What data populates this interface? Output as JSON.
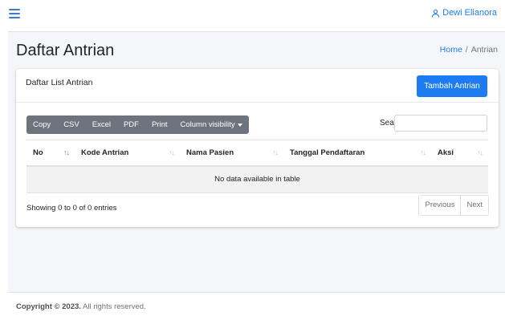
{
  "navbar": {
    "user_name": "Dewi Elianora"
  },
  "page": {
    "title": "Daftar Antrian",
    "breadcrumb": {
      "home": "Home",
      "separator": "/",
      "current": "Antrian"
    }
  },
  "card": {
    "title": "Daftar List Antrian",
    "add_button": "Tambah Antrian"
  },
  "toolbar": {
    "buttons": [
      "Copy",
      "CSV",
      "Excel",
      "PDF",
      "Print",
      "Column visibility"
    ]
  },
  "search": {
    "label": "Search:",
    "value": ""
  },
  "table": {
    "columns": [
      "No",
      "Kode Antrian",
      "Nama Pasien",
      "Tanggal Pendaftaran",
      "Aksi"
    ],
    "empty_message": "No data available in table"
  },
  "pagination": {
    "info": "Showing 0 to 0 of 0 entries",
    "previous": "Previous",
    "next": "Next"
  },
  "footer": {
    "copyright": "Copyright © 2023.",
    "rights": "All rights reserved."
  },
  "colors": {
    "primary": "#1e7cf2",
    "secondary": "#6c757d",
    "background": "#f4f6f9"
  }
}
